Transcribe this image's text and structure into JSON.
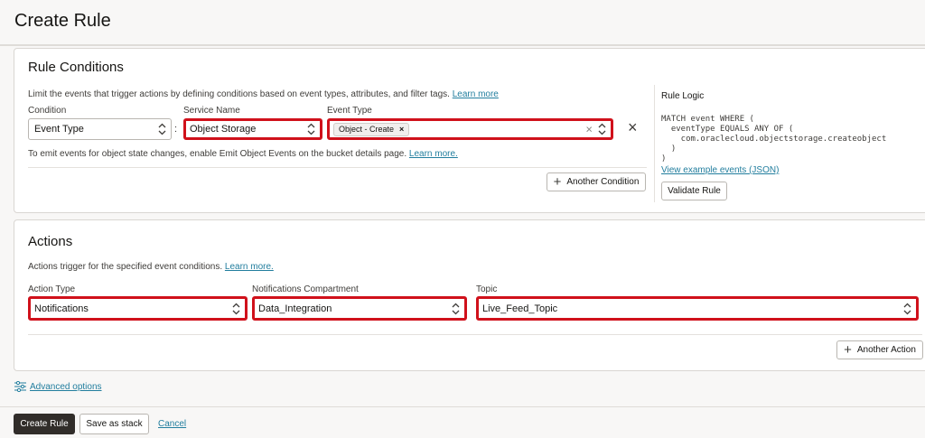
{
  "page": {
    "faint_breadcrumb": "",
    "title": "Create Rule"
  },
  "rule_conditions": {
    "title": "Rule Conditions",
    "description": "Limit the events that trigger actions by defining conditions based on event types, attributes, and filter tags.",
    "learn_more": "Learn more",
    "condition_label": "Condition",
    "condition_value": "Event Type",
    "separator": ":",
    "service_label": "Service Name",
    "service_value": "Object Storage",
    "event_type_label": "Event Type",
    "event_type_chip": "Object - Create",
    "chip_remove": "×",
    "clear_symbol": "×",
    "remove_symbol": "×",
    "hint": "To emit events for object state changes, enable Emit Object Events on the bucket details page.",
    "hint_link": "Learn more.",
    "another_condition": "Another Condition",
    "plus_symbol": "+"
  },
  "rule_logic": {
    "title": "Rule Logic",
    "code": "MATCH event WHERE (\n  eventType EQUALS ANY OF (\n    com.oraclecloud.objectstorage.createobject\n  )\n)",
    "view_example": "View example events (JSON)",
    "validate": "Validate Rule"
  },
  "actions": {
    "title": "Actions",
    "description": "Actions trigger for the specified event conditions.",
    "learn_more": "Learn more.",
    "action_type_label": "Action Type",
    "action_type_value": "Notifications",
    "compartment_label": "Notifications Compartment",
    "compartment_value": "Data_Integration",
    "topic_label": "Topic",
    "topic_value": "Live_Feed_Topic",
    "another_action": "Another Action",
    "plus_symbol": "+"
  },
  "advanced": {
    "label": "Advanced options",
    "icon": "sliders-icon"
  },
  "footer": {
    "create": "Create Rule",
    "save_stack": "Save as stack",
    "cancel": "Cancel"
  },
  "colors": {
    "highlight": "#d0111b",
    "link": "#227e9e",
    "primary_button": "#312d2a"
  }
}
